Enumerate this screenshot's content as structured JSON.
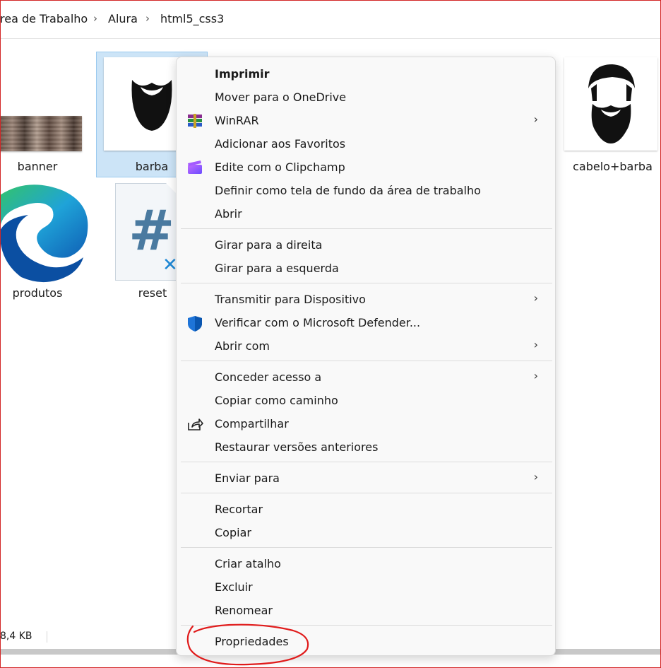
{
  "breadcrumb": {
    "items": [
      "rea de Trabalho",
      "Alura",
      "html5_css3"
    ],
    "separator": "›"
  },
  "files": {
    "banner": "banner",
    "barba": "barba",
    "cabelo_barba": "cabelo+barba",
    "produtos": "produtos",
    "reset": "reset"
  },
  "status": {
    "size": "8,4 KB"
  },
  "menu": {
    "groups": [
      [
        {
          "label": "Imprimir",
          "bold": true
        },
        {
          "label": "Mover para o OneDrive"
        },
        {
          "label": "WinRAR",
          "icon": "winrar-icon",
          "submenu": true
        },
        {
          "label": "Adicionar aos Favoritos"
        },
        {
          "label": "Edite com o Clipchamp",
          "icon": "clipchamp-icon"
        },
        {
          "label": "Definir como tela de fundo da área de trabalho"
        },
        {
          "label": "Abrir"
        }
      ],
      [
        {
          "label": "Girar para a direita"
        },
        {
          "label": "Girar para a esquerda"
        }
      ],
      [
        {
          "label": "Transmitir para Dispositivo",
          "submenu": true
        },
        {
          "label": "Verificar com o Microsoft Defender...",
          "icon": "defender-shield-icon"
        },
        {
          "label": "Abrir com",
          "submenu": true
        }
      ],
      [
        {
          "label": "Conceder acesso a",
          "submenu": true
        },
        {
          "label": "Copiar como caminho"
        },
        {
          "label": "Compartilhar",
          "icon": "share-icon"
        },
        {
          "label": "Restaurar versões anteriores"
        }
      ],
      [
        {
          "label": "Enviar para",
          "submenu": true
        }
      ],
      [
        {
          "label": "Recortar"
        },
        {
          "label": "Copiar"
        }
      ],
      [
        {
          "label": "Criar atalho"
        },
        {
          "label": "Excluir"
        },
        {
          "label": "Renomear"
        }
      ],
      [
        {
          "label": "Propriedades"
        }
      ]
    ],
    "chevron": "›"
  },
  "colors": {
    "selection": "#cce4f7",
    "annotation": "#e01b1b",
    "frame": "#d32626"
  }
}
